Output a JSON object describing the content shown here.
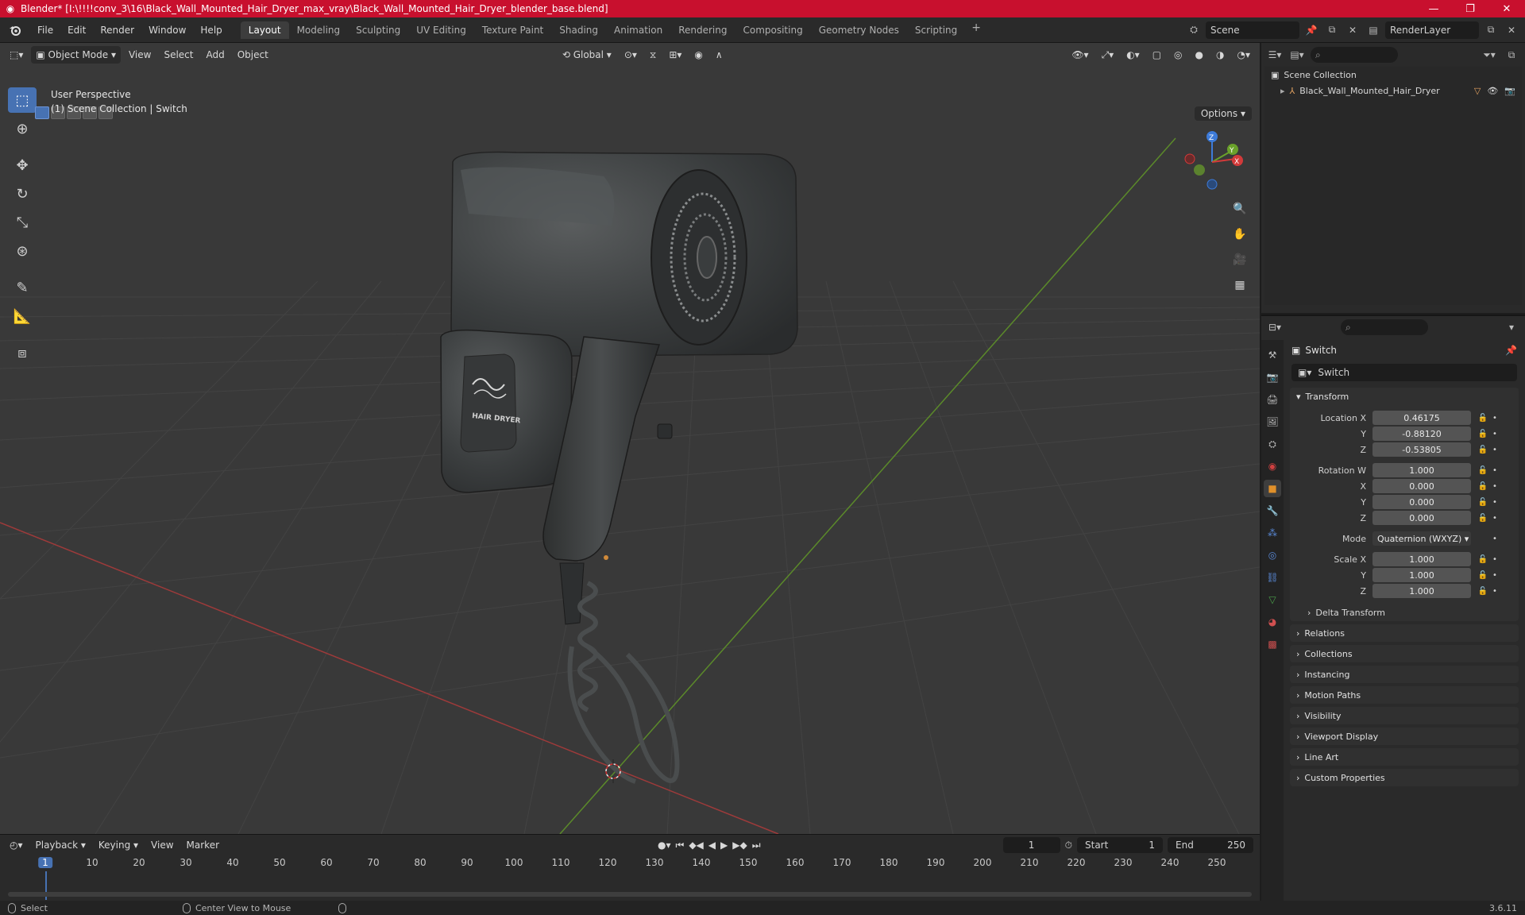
{
  "window": {
    "title": "Blender* [I:\\!!!!conv_3\\16\\Black_Wall_Mounted_Hair_Dryer_max_vray\\Black_Wall_Mounted_Hair_Dryer_blender_base.blend]",
    "minimize": "—",
    "maximize": "❐",
    "close": "✕"
  },
  "menus": [
    "File",
    "Edit",
    "Render",
    "Window",
    "Help"
  ],
  "workspaces": [
    "Layout",
    "Modeling",
    "Sculpting",
    "UV Editing",
    "Texture Paint",
    "Shading",
    "Animation",
    "Rendering",
    "Compositing",
    "Geometry Nodes",
    "Scripting"
  ],
  "active_workspace": "Layout",
  "scene_field": "Scene",
  "render_layer": "RenderLayer",
  "viewport": {
    "mode": "Object Mode",
    "menus": [
      "View",
      "Select",
      "Add",
      "Object"
    ],
    "orientation": "Global",
    "options_label": "Options",
    "overlay_line1": "User Perspective",
    "overlay_line2": "(1) Scene Collection | Switch",
    "gizmo_labels": {
      "x": "X",
      "y": "Y",
      "z": "Z"
    },
    "product_label": "HAIR DRYER",
    "colors": {
      "background": "#393939",
      "grid": "#434343",
      "x_axis": "#9e3a3a",
      "y_axis": "#5b8a2a",
      "selected": "#4772b3"
    }
  },
  "timeline": {
    "menus": [
      "Playback",
      "Keying",
      "View",
      "Marker"
    ],
    "current_frame": "1",
    "start_label": "Start",
    "start": "1",
    "end_label": "End",
    "end": "250",
    "ticks": [
      "1",
      "10",
      "20",
      "30",
      "40",
      "50",
      "60",
      "70",
      "80",
      "90",
      "100",
      "110",
      "120",
      "130",
      "140",
      "150",
      "160",
      "170",
      "180",
      "190",
      "200",
      "210",
      "220",
      "230",
      "240",
      "250"
    ]
  },
  "statusbar": {
    "select": "Select",
    "center_view": "Center View to Mouse",
    "version": "3.6.11"
  },
  "outliner": {
    "root": "Scene Collection",
    "object": "Black_Wall_Mounted_Hair_Dryer"
  },
  "properties": {
    "object_name": "Switch",
    "datablock_name": "Switch",
    "transform_label": "Transform",
    "location_label": "Location X",
    "location": {
      "x": "0.46175",
      "y": "-0.88120",
      "z": "-0.53805"
    },
    "rotation_label": "Rotation W",
    "rotation": {
      "w": "1.000",
      "x": "0.000",
      "y": "0.000",
      "z": "0.000"
    },
    "mode_label": "Mode",
    "mode_value": "Quaternion (WXYZ)",
    "scale_label": "Scale X",
    "scale": {
      "x": "1.000",
      "y": "1.000",
      "z": "1.000"
    },
    "axis_y": "Y",
    "axis_x": "X",
    "axis_z": "Z",
    "delta_transform": "Delta Transform",
    "panels": [
      "Relations",
      "Collections",
      "Instancing",
      "Motion Paths",
      "Visibility",
      "Viewport Display",
      "Line Art",
      "Custom Properties"
    ]
  }
}
